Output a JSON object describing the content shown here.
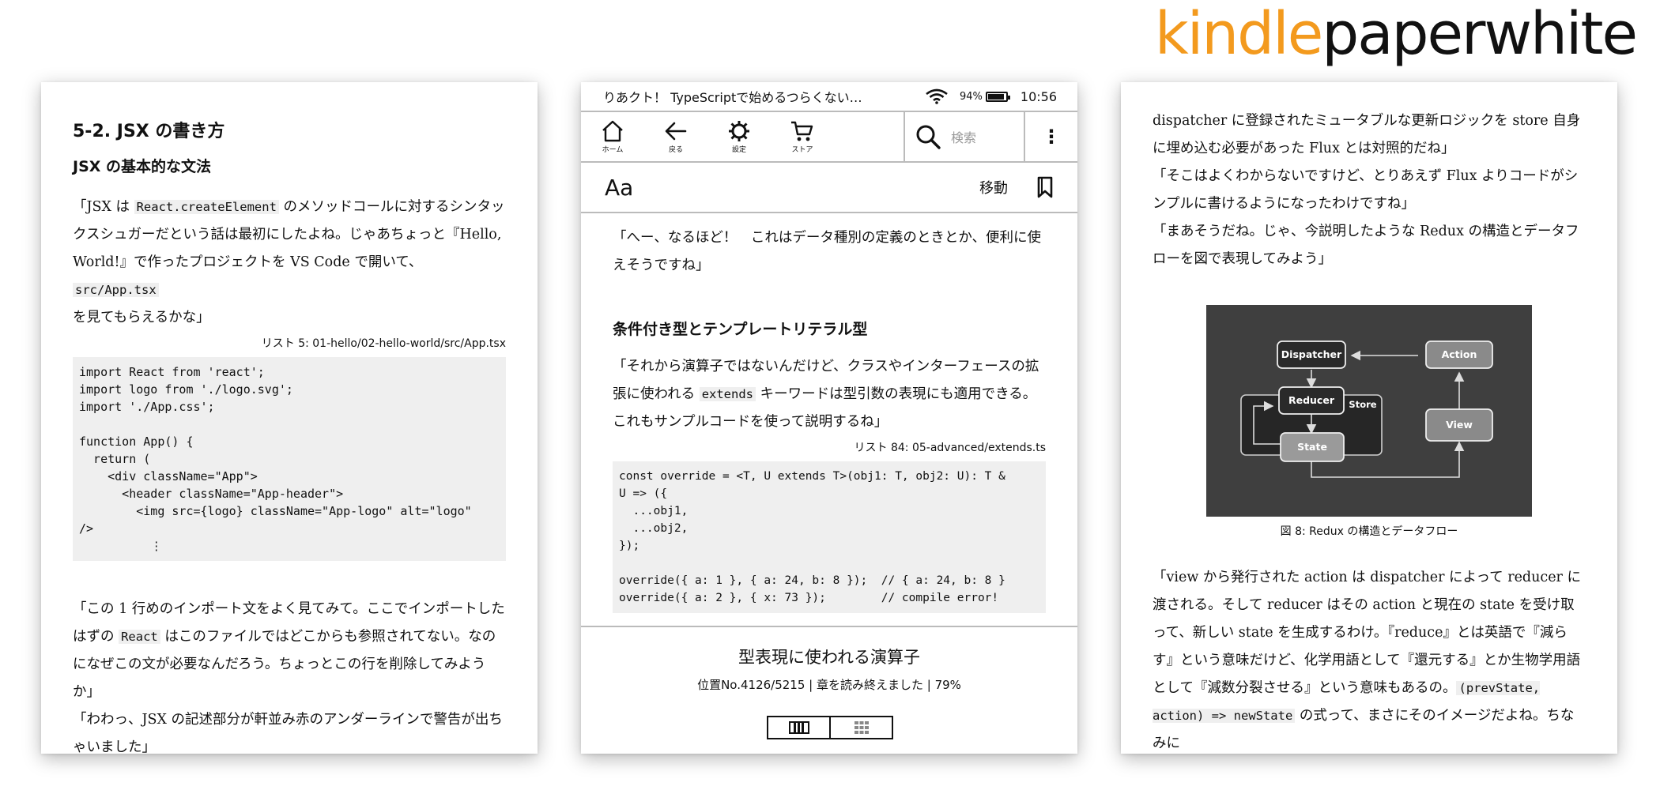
{
  "brand": {
    "kindle": "kindle",
    "paperwhite": "paperwhite"
  },
  "left": {
    "section_heading": "5-2. JSX の書き方",
    "subheading": "JSX の基本的な文法",
    "para1_a": "「JSX は ",
    "para1_code1": "React.createElement",
    "para1_b": " のメソッドコールに対するシンタックスシュガーだという話は最初にしたよね。じゃあちょっと『Hello, World!』で作ったプロジェクトを VS Code で開いて、",
    "para1_code2": "src/App.tsx",
    "para1_c": " を見てもらえるかな」",
    "listing_caption": "リスト 5: 01-hello/02-hello-world/src/App.tsx",
    "code": "import React from 'react';\nimport logo from './logo.svg';\nimport './App.css';\n\nfunction App() {\n  return (\n    <div className=\"App\">\n      <header className=\"App-header\">\n        <img src={logo} className=\"App-logo\" alt=\"logo\"\n/>\n          ⋮",
    "para2_a": "「この 1 行めのインポート文をよく見てみて。ここでインポートしたはずの ",
    "para2_code": "React",
    "para2_b": " はこのファイルではどこからも参照されてない。なのになぜこの文が必要なんだろう。ちょっとこの行を削除してみようか」",
    "para3": "「わわっ、JSX の記述部分が軒並み赤のアンダーラインで警告が出ちゃいました」"
  },
  "middle": {
    "status": {
      "book_title": "りあクト！ TypeScriptで始めるつらくない…",
      "battery": "94%",
      "battery_level": 0.94,
      "time": "10:56"
    },
    "toolbar": {
      "home": "ホーム",
      "back": "戻る",
      "settings": "設定",
      "store": "ストア",
      "search_placeholder": "検索",
      "menu": "⋮"
    },
    "readbar": {
      "aa": "Aa",
      "move": "移動"
    },
    "para1": "「へー、なるほど！　これはデータ種別の定義のときとか、便利に使えそうですね」",
    "heading": "条件付き型とテンプレートリテラル型",
    "para2_a": "「それから演算子ではないんだけど、クラスやインターフェースの拡張に使われる ",
    "para2_code": "extends",
    "para2_b": " キーワードは型引数の表現にも適用できる。これもサンプルコードを使って説明するね」",
    "listing_caption": "リスト 84: 05-advanced/extends.ts",
    "code": "const override = <T, U extends T>(obj1: T, obj2: U): T &\nU => ({\n  ...obj1,\n  ...obj2,\n});\n\noverride({ a: 1 }, { a: 24, b: 8 });  // { a: 24, b: 8 }\noverride({ a: 2 }, { x: 73 });        // compile error!",
    "footer": {
      "chapter_title": "型表現に使われる演算子",
      "location": "位置No.4126/5215 | 章を読み終えました | 79%"
    }
  },
  "right": {
    "para1": "dispatcher に登録されたミュータブルな更新ロジックを store 自身に埋め込む必要があった Flux とは対照的だね」",
    "para2": "「そこはよくわからないですけど、とりあえず Flux よりコードがシンプルに書けるようになったわけですね」",
    "para3": "「まあそうだね。じゃ、今説明したような Redux の構造とデータフローを図で表現してみよう」",
    "figure": {
      "nodes": {
        "dispatcher": "Dispatcher",
        "action": "Action",
        "reducer": "Reducer",
        "store": "Store",
        "view": "View",
        "state": "State"
      },
      "caption": "図 8: Redux の構造とデータフロー"
    },
    "para4_a": "「view から発行された action は dispatcher によって reducer に渡される。そして reducer はその action と現在の state を受け取って、新しい state を生成するわけ。『reduce』とは英語で『減らす』という意味だけど、化学用語として『還元する』とか生物学用語として『減数分裂させる』という意味もあるの。",
    "para4_code": "(prevState, action) => newState",
    "para4_b": " の式って、まさにそのイメージだよね。ちなみに"
  }
}
